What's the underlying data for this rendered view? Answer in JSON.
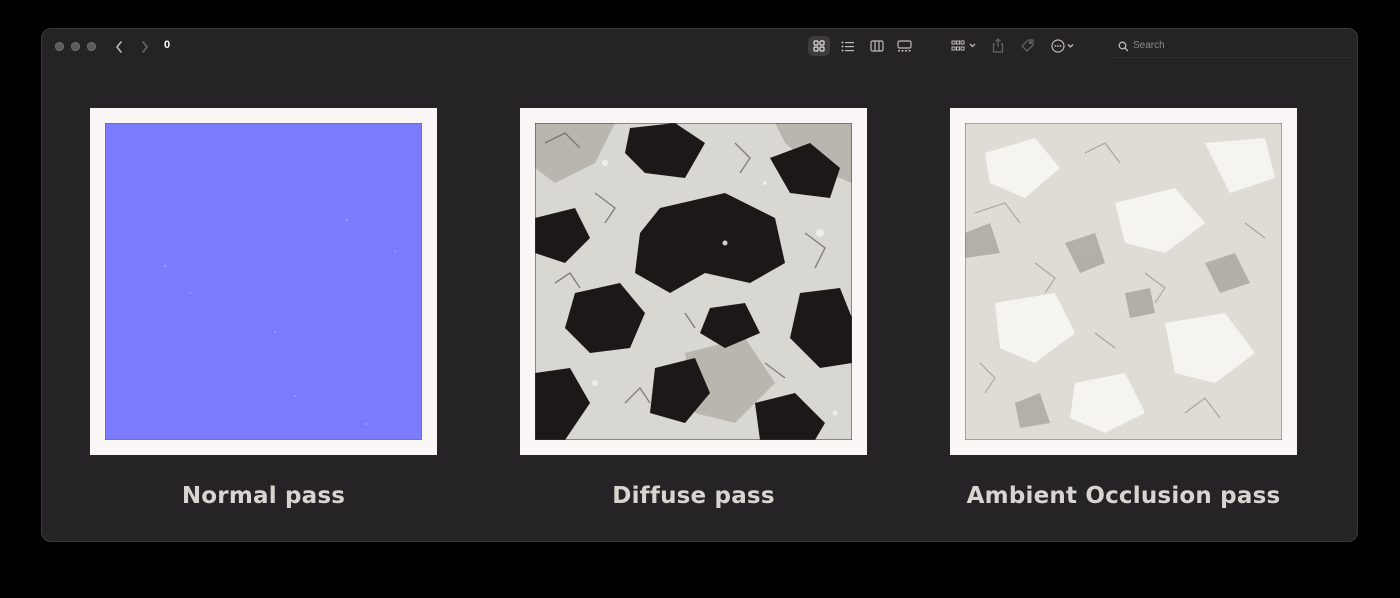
{
  "window": {
    "folder_title": "0",
    "traffic_lights": [
      "close",
      "minimize",
      "zoom"
    ]
  },
  "toolbar": {
    "back_icon": "chevron-left-icon",
    "forward_icon": "chevron-right-icon",
    "view_modes": [
      "icon-view",
      "list-view",
      "column-view",
      "gallery-view"
    ],
    "selected_view": "icon-view",
    "group_icon": "group-by-icon",
    "share_icon": "share-icon",
    "tag_icon": "tag-icon",
    "more_icon": "ellipsis-circle-icon",
    "search_placeholder": "Search"
  },
  "items": [
    {
      "caption": "Normal pass",
      "kind": "normal-map",
      "color": "#7a7bfd"
    },
    {
      "caption": "Diffuse pass",
      "kind": "diffuse",
      "color": "#1c1818"
    },
    {
      "caption": "Ambient Occlusion pass",
      "kind": "ambient-occlusion",
      "color": "#dedcd4"
    }
  ],
  "colors": {
    "window_bg": "#262326",
    "frame_bg": "#faf6f5",
    "caption": "#d8d4d0"
  }
}
